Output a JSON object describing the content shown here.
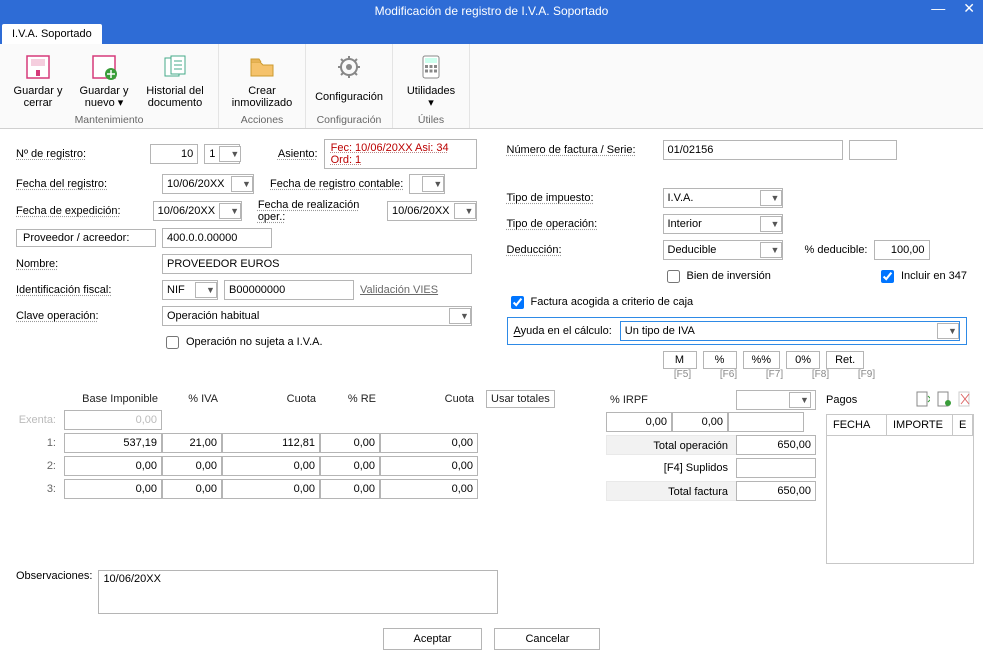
{
  "window": {
    "title": "Modificación de registro de I.V.A. Soportado",
    "tab": "I.V.A. Soportado"
  },
  "ribbon": {
    "g1": {
      "title": "Mantenimiento",
      "items": [
        {
          "label": "Guardar y cerrar",
          "icon": "save-close"
        },
        {
          "label": "Guardar y nuevo ▾",
          "icon": "save-new"
        },
        {
          "label": "Historial del documento",
          "icon": "history"
        }
      ]
    },
    "g2": {
      "title": "Acciones",
      "items": [
        {
          "label": "Crear inmovilizado",
          "icon": "folder-plus"
        }
      ]
    },
    "g3": {
      "title": "Configuración",
      "items": [
        {
          "label": "Configuración",
          "icon": "gear"
        }
      ]
    },
    "g4": {
      "title": "Útiles",
      "items": [
        {
          "label": "Utilidades ▾",
          "icon": "calculator"
        }
      ]
    }
  },
  "left": {
    "n_registro_lbl": "Nº de registro:",
    "n_registro": "10",
    "n_registro_sub": "1",
    "fecha_reg_lbl": "Fecha del registro:",
    "fecha_reg": "10/06/20XX",
    "fecha_exp_lbl": "Fecha de expedición:",
    "fecha_exp": "10/06/20XX",
    "proveedor_lbl": "Proveedor / acreedor:",
    "proveedor": "400.0.0.00000",
    "nombre_lbl": "Nombre:",
    "nombre": "PROVEEDOR EUROS",
    "id_fiscal_lbl": "Identificación fiscal:",
    "id_tipo": "NIF",
    "id_num": "B00000000",
    "id_link": "Validación VIES",
    "clave_lbl": "Clave operación:",
    "clave": "Operación habitual",
    "no_sujeta": "Operación no sujeta a I.V.A.",
    "asiento_lbl": "Asiento:",
    "asiento": "Fec: 10/06/20XX Asi: 34 Ord: 1",
    "fecha_cont_lbl": "Fecha de registro contable:",
    "fecha_cont": "",
    "fecha_real_lbl": "Fecha de realización oper.:",
    "fecha_real": "10/06/20XX"
  },
  "right": {
    "numfact_lbl": "Número de factura / Serie:",
    "numfact": "01/02156",
    "serie": "",
    "tipo_imp_lbl": "Tipo de impuesto:",
    "tipo_imp": "I.V.A.",
    "tipo_op_lbl": "Tipo de operación:",
    "tipo_op": "Interior",
    "deduccion_lbl": "Deducción:",
    "deduccion": "Deducible",
    "pct_ded_lbl": "% deducible:",
    "pct_ded": "100,00",
    "bien_inv": "Bien de inversión",
    "incluir347": "Incluir en 347",
    "criterio_caja": "Factura acogida a criterio de caja",
    "ayuda_lbl": "Ayuda en el cálculo:",
    "ayuda": "Un tipo de IVA",
    "btns": {
      "m": "M",
      "pct": "%",
      "pctpct": "%%",
      "pct0": "0%",
      "ret": "Ret."
    },
    "hints": {
      "m": "[F5]",
      "pct": "[F6]",
      "pctpct": "[F7]",
      "pct0": "[F8]",
      "ret": "[F9]"
    }
  },
  "grid": {
    "headers": {
      "base": "Base Imponible",
      "piva": "% IVA",
      "cuota": "Cuota",
      "pre": "% RE",
      "cuota2": "Cuota",
      "usar": "Usar totales",
      "irpf": "% IRPF"
    },
    "exenta_lbl": "Exenta:",
    "exenta": "0,00",
    "rows": [
      {
        "lbl": "1:",
        "base": "537,19",
        "piva": "21,00",
        "cuota": "112,81",
        "pre": "0,00",
        "cuota2": "0,00"
      },
      {
        "lbl": "2:",
        "base": "0,00",
        "piva": "0,00",
        "cuota": "0,00",
        "pre": "0,00",
        "cuota2": "0,00"
      },
      {
        "lbl": "3:",
        "base": "0,00",
        "piva": "0,00",
        "cuota": "0,00",
        "pre": "0,00",
        "cuota2": "0,00"
      }
    ],
    "irpf_base": "0,00",
    "irpf_pct": "0,00",
    "irpf_btn": "",
    "totals": {
      "op_lbl": "Total operación",
      "op": "650,00",
      "sup_lbl": "[F4] Suplidos",
      "sup": "",
      "fac_lbl": "Total factura",
      "fac": "650,00"
    },
    "pagos_lbl": "Pagos",
    "pagos_cols": {
      "fecha": "FECHA",
      "importe": "IMPORTE",
      "e": "E"
    }
  },
  "obs": {
    "lbl": "Observaciones:",
    "text": "10/06/20XX"
  },
  "footer": {
    "ok": "Aceptar",
    "cancel": "Cancelar"
  }
}
